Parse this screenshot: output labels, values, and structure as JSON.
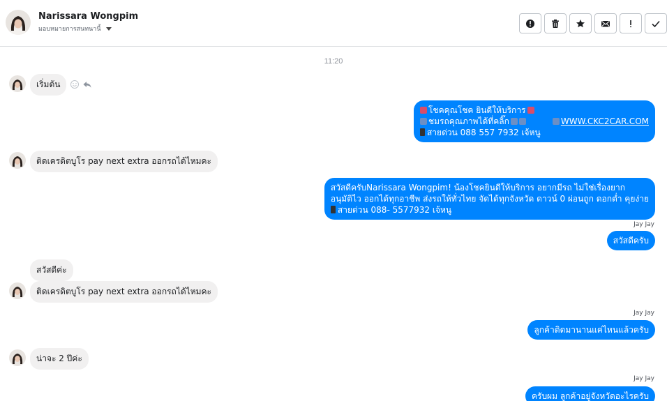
{
  "header": {
    "contact_name": "Narissara Wongpim",
    "assign_label": "มอบหมายการสนทนานี้"
  },
  "actions": [
    {
      "name": "report-icon",
      "label": ""
    },
    {
      "name": "trash-icon",
      "label": ""
    },
    {
      "name": "star-icon",
      "label": ""
    },
    {
      "name": "mail-icon",
      "label": ""
    },
    {
      "name": "exclamation-icon",
      "label": ""
    },
    {
      "name": "check-icon",
      "label": ""
    }
  ],
  "thread": {
    "timestamp": "11:20",
    "msg1": "เริ่มต้น",
    "promo": {
      "line1": "โชคคุณโชค ยินดีให้บริการ",
      "line2_a": "ชมรถคุณภาพได้ที่คลิ๊ก",
      "line2_link": "WWW.CKC2CAR.COM",
      "line3": "สายด่วน 088 557 7932 เจ้หนู"
    },
    "msg2": "ติดเครดิตบูโร pay next extra ออกรถได้ไหมคะ",
    "greeting": {
      "line1": "สวัสดีครับNarissara Wongpim! น้องโชคยินดีให้บริการ อยากมีรถ ไม่ใช่เรื่องยาก",
      "line2": "อนุมัติไว ออกได้ทุกอาชีพ ส่งรถให้ทั่วไทย จัดได้ทุกจังหวัด ดาวน์ 0  ผ่อนถูก ดอกต่ำ คุยง่าย",
      "line3": "สายด่วน 088- 5577932 เจ้หนู"
    },
    "sender1": "Jay Jay",
    "reply1": "สวัสดีครับ",
    "msg3": "สวัสดีค่ะ",
    "msg4": "ติดเครดิตบูโร pay next extra ออกรถได้ไหมคะ",
    "sender2": "Jay Jay",
    "reply2": "ลูกค้าติดมานานแค่ไหนแล้วครับ",
    "msg5": "น่าจะ 2 ปีค่ะ",
    "sender3": "Jay Jay",
    "reply3": "ครับผม ลูกค้าอยู่จังหวัดอะไรครับ"
  },
  "colors": {
    "outgoing": "#0084ff",
    "incoming": "#f1f0f0"
  }
}
